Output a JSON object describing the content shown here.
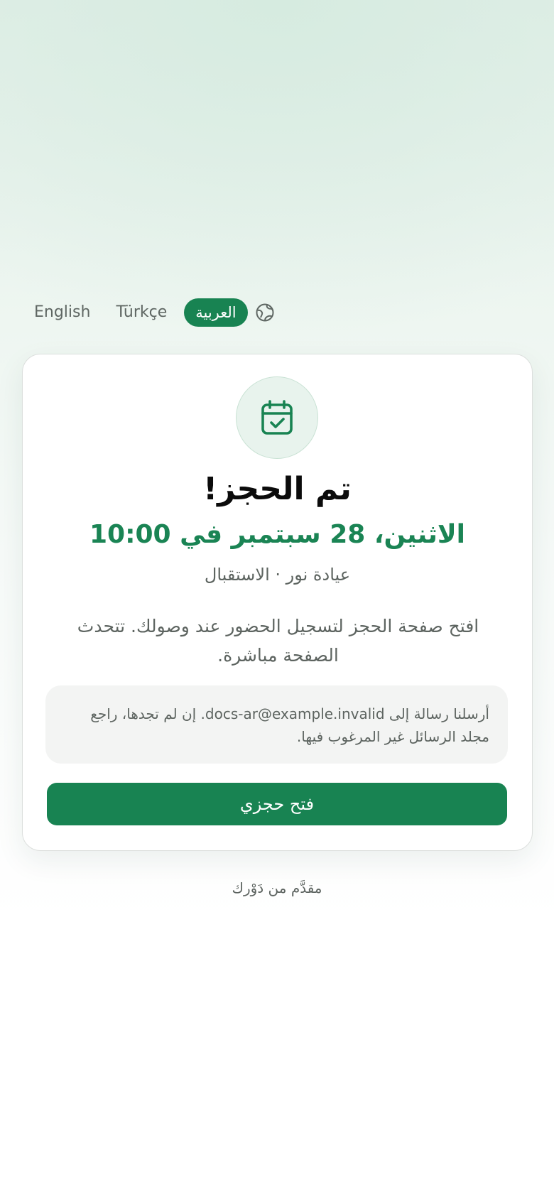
{
  "language_switcher": {
    "options": [
      "English",
      "Türkçe",
      "العربية"
    ],
    "selected": "العربية",
    "icon": "globe-icon"
  },
  "card": {
    "icon": "calendar-check-icon",
    "title": "تم الحجز!",
    "datetime": "الاثنين، 28 سبتمبر في 10:00",
    "place": "عيادة نور · الاستقبال",
    "description": "افتح صفحة الحجز لتسجيل الحضور عند وصولك. تتحدث الصفحة مباشرة.",
    "note": "أرسلنا رسالة إلى docs-ar@example.invalid. إن لم تجدها، راجع مجلد الرسائل غير المرغوب فيها.",
    "cta_label": "فتح حجزي"
  },
  "footer": {
    "powered_by": "مقدَّم من دَوْرك"
  },
  "colors": {
    "accent": "#188352",
    "accent_text": "#1a8454"
  }
}
